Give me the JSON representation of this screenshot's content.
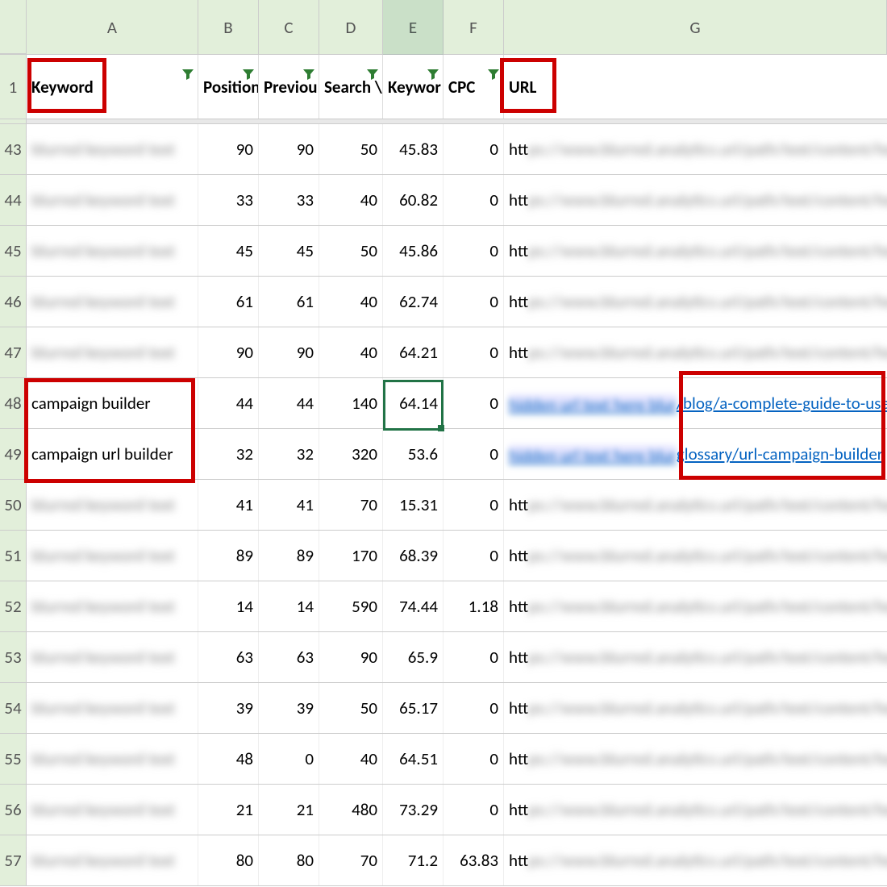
{
  "columns": {
    "letters": [
      "A",
      "B",
      "C",
      "D",
      "E",
      "F",
      "G"
    ],
    "widths": [
      213,
      75,
      75,
      79,
      75,
      75,
      475
    ]
  },
  "headers": {
    "keyword": "Keyword",
    "position": "Position",
    "previous": "Previou",
    "search": "Search \\",
    "keyworddiff": "Keywor",
    "cpc": "CPC",
    "url": "URL"
  },
  "header_row_num": "1",
  "rows": [
    {
      "num": "43",
      "keyword": "blurred",
      "position": "90",
      "previous": "90",
      "search": "50",
      "kd": "45.83",
      "cpc": "0",
      "url": "blurred",
      "suffix": "plat"
    },
    {
      "num": "44",
      "keyword": "blurred",
      "position": "33",
      "previous": "33",
      "search": "40",
      "kd": "60.82",
      "cpc": "0",
      "url": "blurred",
      "suffix": "sis-d"
    },
    {
      "num": "45",
      "keyword": "blurred",
      "position": "45",
      "previous": "45",
      "search": "50",
      "kd": "45.86",
      "cpc": "0",
      "url": "blurred",
      "suffix": "analy"
    },
    {
      "num": "46",
      "keyword": "blurred",
      "position": "61",
      "previous": "61",
      "search": "40",
      "kd": "62.74",
      "cpc": "0",
      "url": "blurred",
      "suffix": ""
    },
    {
      "num": "47",
      "keyword": "blurred",
      "position": "90",
      "previous": "90",
      "search": "40",
      "kd": "64.21",
      "cpc": "0",
      "url": "blurred",
      "suffix": ""
    },
    {
      "num": "48",
      "keyword": "campaign builder",
      "position": "44",
      "previous": "44",
      "search": "140",
      "kd": "64.14",
      "cpc": "0",
      "url": "link",
      "url_clear": "/blog/a-complete-guide-to-use-campaig"
    },
    {
      "num": "49",
      "keyword": "campaign url builder",
      "position": "32",
      "previous": "32",
      "search": "320",
      "kd": "53.6",
      "cpc": "0",
      "url": "link",
      "url_clear": "glossary/url-campaign-builder"
    },
    {
      "num": "50",
      "keyword": "blurred",
      "position": "41",
      "previous": "41",
      "search": "70",
      "kd": "15.31",
      "cpc": "0",
      "url": "blurred",
      "suffix": "plat"
    },
    {
      "num": "51",
      "keyword": "blurred",
      "position": "89",
      "previous": "89",
      "search": "170",
      "kd": "68.39",
      "cpc": "0",
      "url": "blurred",
      "suffix": ""
    },
    {
      "num": "52",
      "keyword": "blurred",
      "position": "14",
      "previous": "14",
      "search": "590",
      "kd": "74.44",
      "cpc": "1.18",
      "url": "blurred",
      "suffix": ""
    },
    {
      "num": "53",
      "keyword": "blurred",
      "position": "63",
      "previous": "63",
      "search": "90",
      "kd": "65.9",
      "cpc": "0",
      "url": "blurred",
      "suffix": "sc"
    },
    {
      "num": "54",
      "keyword": "blurred",
      "position": "39",
      "previous": "39",
      "search": "50",
      "kd": "65.17",
      "cpc": "0",
      "url": "blurred",
      "suffix": ""
    },
    {
      "num": "55",
      "keyword": "blurred",
      "position": "48",
      "previous": "0",
      "search": "40",
      "kd": "64.51",
      "cpc": "0",
      "url": "blurred",
      "suffix": "le,"
    },
    {
      "num": "56",
      "keyword": "blurred",
      "position": "21",
      "previous": "21",
      "search": "480",
      "kd": "73.29",
      "cpc": "0",
      "url": "blurred",
      "suffix": "le,"
    },
    {
      "num": "57",
      "keyword": "blurred",
      "position": "80",
      "previous": "80",
      "search": "70",
      "kd": "71.2",
      "cpc": "63.83",
      "url": "blurred",
      "suffix": ""
    }
  ],
  "annotations": {
    "keyword_header": true,
    "url_header": true,
    "keyword_rows": true,
    "url_rows": true
  }
}
